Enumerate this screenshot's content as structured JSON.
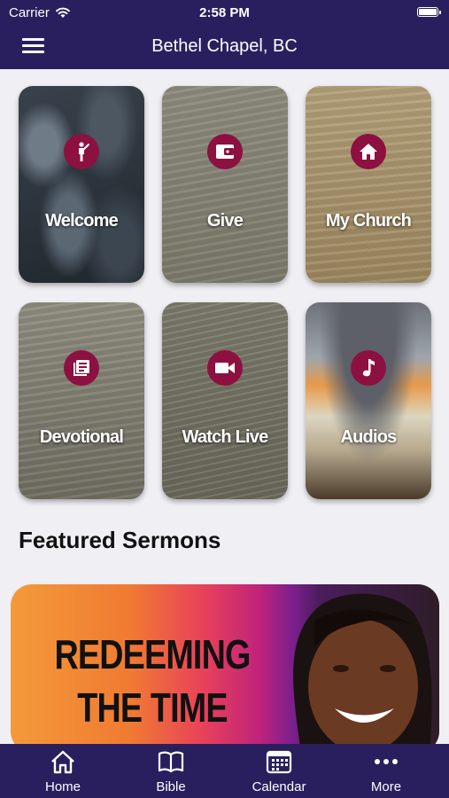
{
  "status": {
    "carrier": "Carrier",
    "time": "2:58 PM"
  },
  "header": {
    "title": "Bethel Chapel, BC"
  },
  "tiles": [
    {
      "label": "Welcome",
      "icon": "person-icon"
    },
    {
      "label": "Give",
      "icon": "wallet-icon"
    },
    {
      "label": "My Church",
      "icon": "home-icon"
    },
    {
      "label": "Devotional",
      "icon": "book-icon"
    },
    {
      "label": "Watch Live",
      "icon": "video-icon"
    },
    {
      "label": "Audios",
      "icon": "music-note-icon"
    }
  ],
  "featured": {
    "title": "Featured Sermons",
    "banner": {
      "line1": "REDEEMING",
      "line2": "THE TIME"
    }
  },
  "tabs": [
    {
      "label": "Home",
      "icon": "home-tab-icon"
    },
    {
      "label": "Bible",
      "icon": "book-open-icon"
    },
    {
      "label": "Calendar",
      "icon": "calendar-icon"
    },
    {
      "label": "More",
      "icon": "more-dots-icon"
    }
  ],
  "colors": {
    "bar": "#2a1f5e",
    "badge": "#8c1040",
    "background": "#efeff4"
  }
}
